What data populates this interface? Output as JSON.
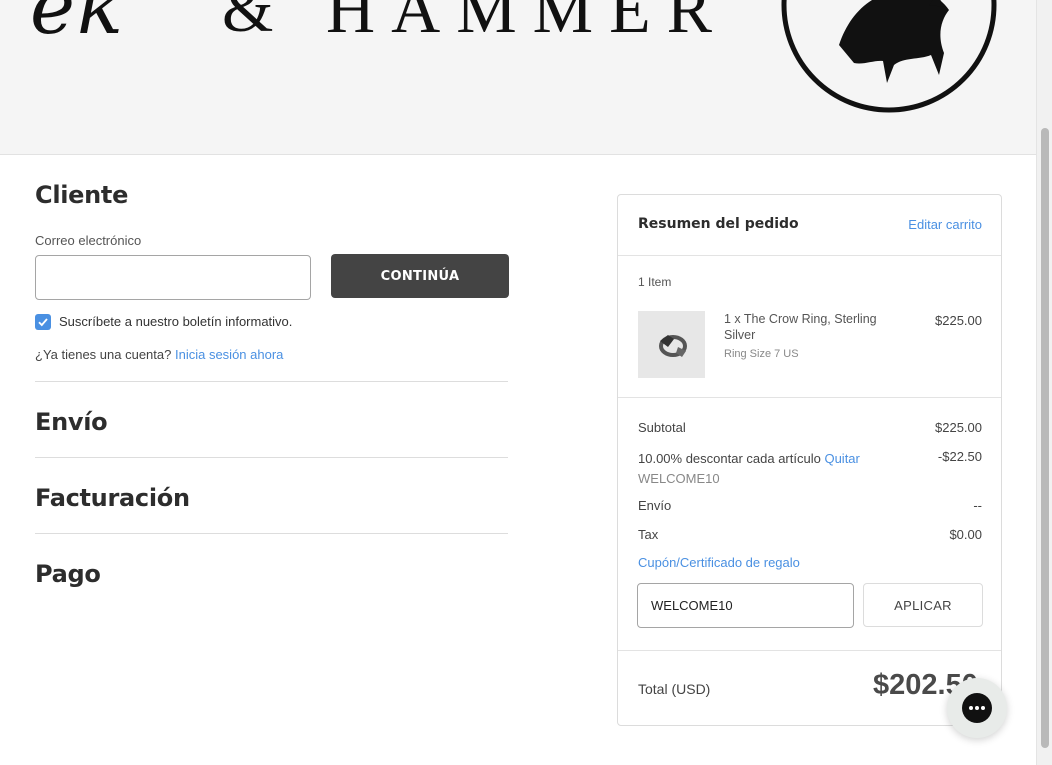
{
  "header": {
    "logo_script": "ek",
    "logo_amp": "&",
    "logo_word": "HAMMER"
  },
  "customer": {
    "title": "Cliente",
    "email_label": "Correo electrónico",
    "email_value": "",
    "continue_label": "CONTINÚA",
    "newsletter_label": "Suscríbete a nuestro boletín informativo.",
    "newsletter_checked": true,
    "account_prompt": "¿Ya tienes una cuenta?",
    "signin_label": "Inicia sesión ahora"
  },
  "sections": {
    "shipping": "Envío",
    "billing": "Facturación",
    "payment": "Pago"
  },
  "summary": {
    "title": "Resumen del pedido",
    "edit_cart": "Editar carrito",
    "item_count": "1 Item",
    "item": {
      "name": "1 x The Crow Ring, Sterling Silver",
      "option": "Ring Size 7 US",
      "price": "$225.00"
    },
    "subtotal_label": "Subtotal",
    "subtotal_value": "$225.00",
    "discount_label": "10.00% descontar cada artículo",
    "discount_remove": "Quitar",
    "discount_code": "WELCOME10",
    "discount_value": "-$22.50",
    "shipping_label": "Envío",
    "shipping_value": "--",
    "tax_label": "Tax",
    "tax_value": "$0.00",
    "coupon_label": "Cupón/Certificado de regalo",
    "coupon_value": "WELCOME10",
    "apply_label": "APLICAR",
    "total_label": "Total (USD)",
    "total_value": "$202.50"
  },
  "colors": {
    "accent": "#4a90e2",
    "button_dark": "#444444",
    "header_bg": "#f5f5f5"
  },
  "icons": {
    "checkbox": "checkmark-icon",
    "chat": "chat-ellipsis-icon",
    "seal": "crow-seal-icon"
  }
}
